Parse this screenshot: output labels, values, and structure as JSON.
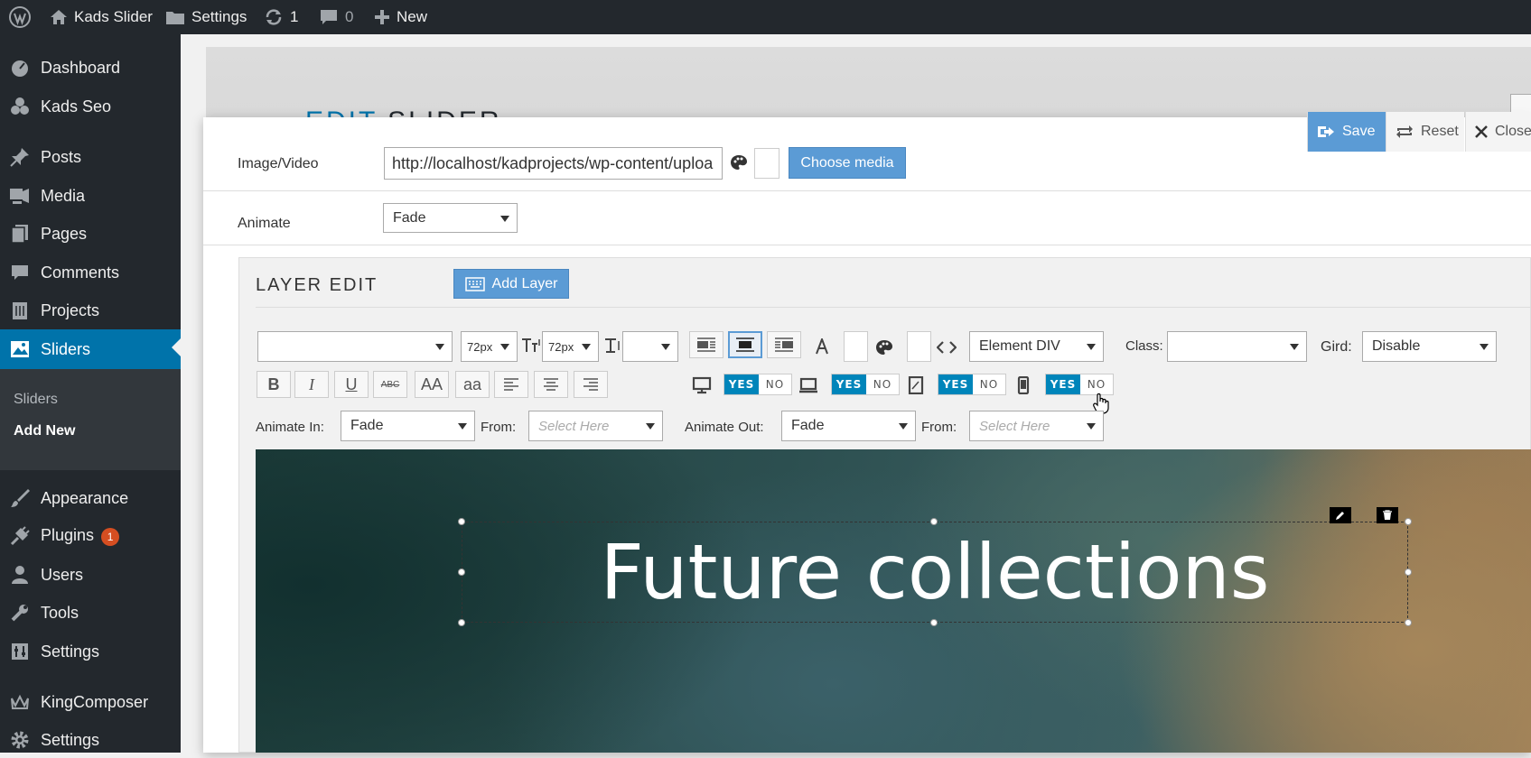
{
  "admin_bar": {
    "site_name": "Kads Slider",
    "settings": "Settings",
    "updates_count": "1",
    "comments_count": "0",
    "new": "New"
  },
  "sidebar": {
    "items": [
      {
        "label": "Dashboard",
        "icon": "dashboard-icon"
      },
      {
        "label": "Kads Seo",
        "icon": "seo-icon"
      },
      {
        "label": "Posts",
        "icon": "pin-icon"
      },
      {
        "label": "Media",
        "icon": "media-icon"
      },
      {
        "label": "Pages",
        "icon": "pages-icon"
      },
      {
        "label": "Comments",
        "icon": "comments-icon"
      },
      {
        "label": "Projects",
        "icon": "projects-icon"
      },
      {
        "label": "Sliders",
        "icon": "sliders-icon"
      },
      {
        "label": "Appearance",
        "icon": "brush-icon"
      },
      {
        "label": "Plugins",
        "icon": "plugin-icon",
        "badge": "1"
      },
      {
        "label": "Users",
        "icon": "users-icon"
      },
      {
        "label": "Tools",
        "icon": "tools-icon"
      },
      {
        "label": "Settings",
        "icon": "settings-icon"
      },
      {
        "label": "KingComposer",
        "icon": "crown-icon"
      },
      {
        "label": "Settings",
        "icon": "gear-icon"
      }
    ],
    "submenu": [
      "Sliders",
      "Add New"
    ]
  },
  "background_page": {
    "title_part1": "EDIT",
    "title_part2": "SLIDER"
  },
  "modal": {
    "save": "Save",
    "reset": "Reset",
    "close": "Close",
    "image_label": "Image/Video",
    "image_url": "http://localhost/kadprojects/wp-content/uploa",
    "choose_media": "Choose media",
    "animate_label": "Animate",
    "animate_value": "Fade"
  },
  "layer_edit": {
    "title": "LAYER EDIT",
    "add_layer": "Add Layer",
    "font_size_1": "72px",
    "font_size_2": "72px",
    "element_select": "Element DIV",
    "class_label": "Class:",
    "grid_label": "Gird:",
    "grid_value": "Disable",
    "format_buttons": [
      "B",
      "I",
      "U",
      "ABC",
      "AA",
      "aa"
    ],
    "yes": "YES",
    "no": "NO",
    "animate_in_label": "Animate In:",
    "animate_in_value": "Fade",
    "from_label": "From:",
    "from_placeholder": "Select Here",
    "animate_out_label": "Animate Out:",
    "animate_out_value": "Fade",
    "from_label_2": "From:",
    "from_placeholder_2": "Select Here"
  },
  "canvas": {
    "layer_text": "Future collections"
  },
  "colors": {
    "admin_dark": "#23282d",
    "accent_blue": "#0073aa",
    "button_blue": "#5b9bd5",
    "toggle_blue": "#0085ba",
    "badge_red": "#d54e21"
  }
}
